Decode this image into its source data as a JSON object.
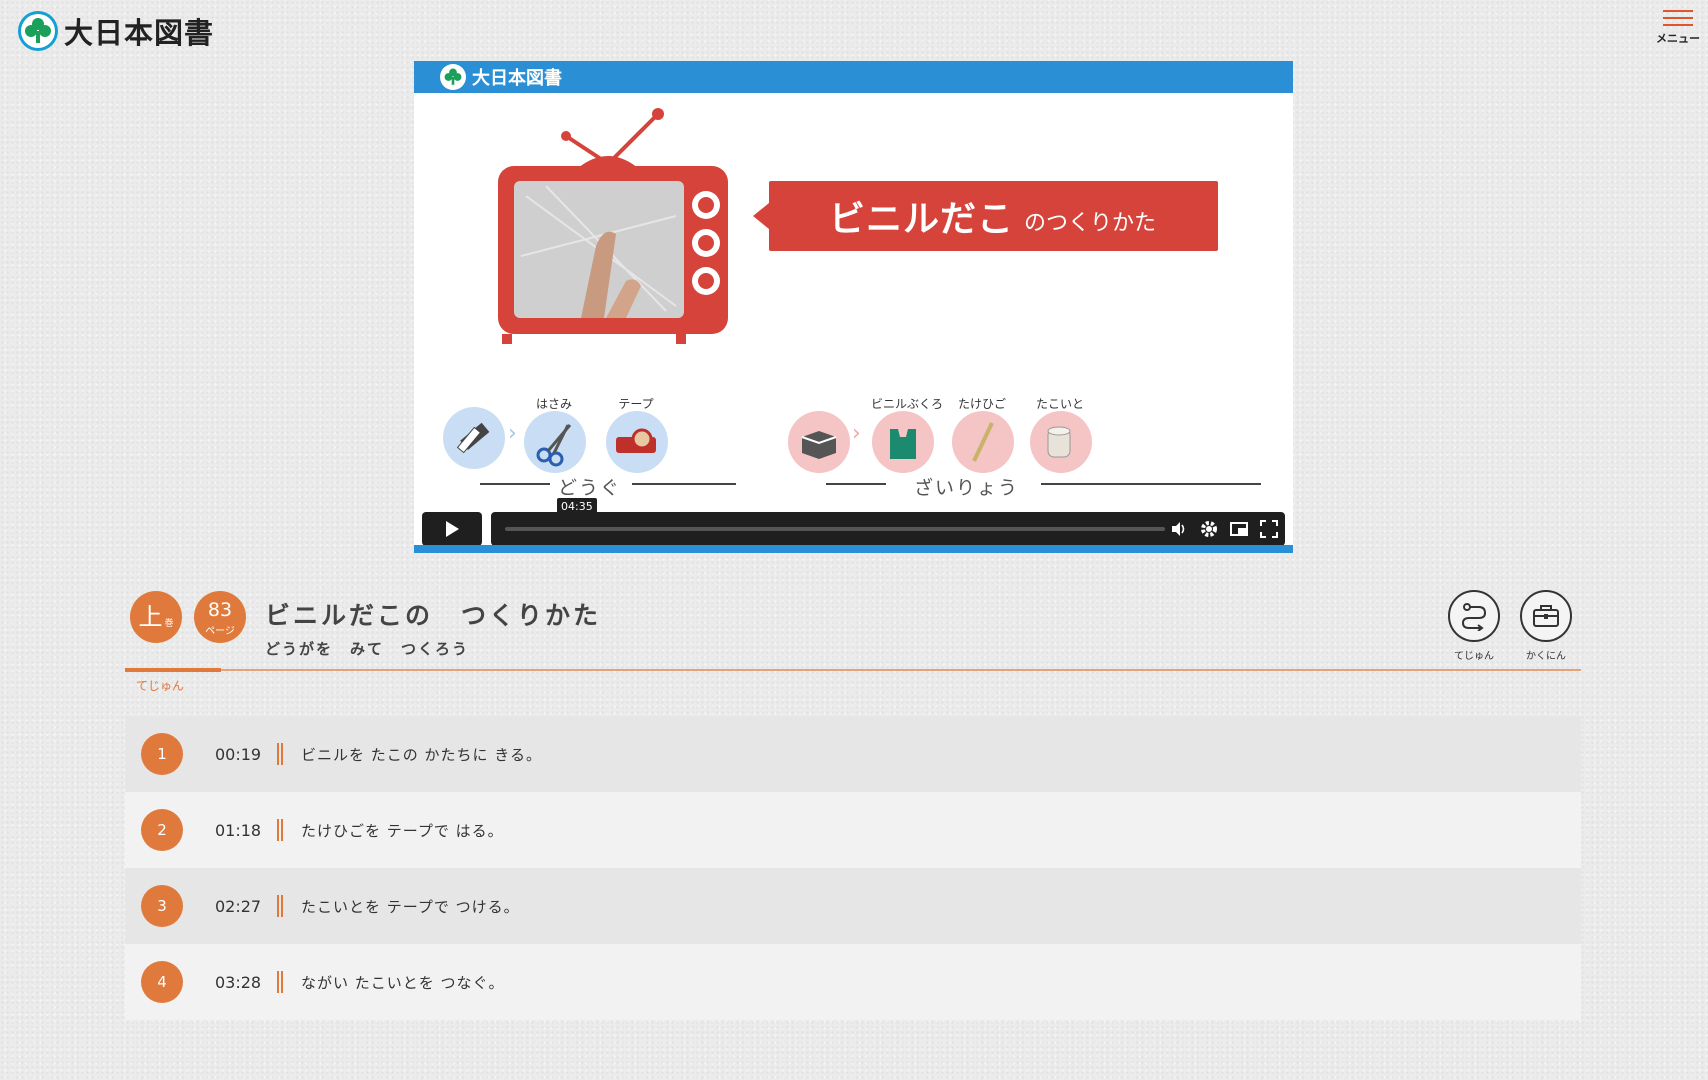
{
  "header": {
    "logo_text": "大日本図書",
    "menu_label": "メニュー"
  },
  "video": {
    "top_logo_text": "大日本図書",
    "title_big": "ビニルだこ",
    "title_small": "のつくりかた",
    "tools": {
      "group_label": "どうぐ",
      "items": [
        "はさみ",
        "テープ"
      ]
    },
    "materials": {
      "group_label": "ざいりょう",
      "items": [
        "ビニルぶくろ",
        "たけひご",
        "たこいと"
      ]
    },
    "time_tooltip": "04:35",
    "icons": [
      "play-icon",
      "volume-icon",
      "settings-icon",
      "pip-icon",
      "fullscreen-icon"
    ]
  },
  "lesson": {
    "volume_char": "上",
    "volume_suffix": "巻",
    "page_number": "83",
    "page_suffix": "ページ",
    "title": "ビニルだこの　つくりかた",
    "subtitle": "どうがを　みて　つくろう",
    "active_tab": "てじゅん",
    "buttons": {
      "steps_label": "てじゅん",
      "check_label": "かくにん"
    }
  },
  "steps": [
    {
      "num": "1",
      "time": "00:19",
      "text": "ビニルを たこの かたちに きる。"
    },
    {
      "num": "2",
      "time": "01:18",
      "text": "たけひごを テープで はる。"
    },
    {
      "num": "3",
      "time": "02:27",
      "text": "たこいとを テープで つける。"
    },
    {
      "num": "4",
      "time": "03:28",
      "text": "ながい たこいとを つなぐ。"
    }
  ],
  "colors": {
    "accent": "#e07a3c",
    "video_blue": "#2b8fd6",
    "banner_red": "#d5433a",
    "logo_blue": "#14a0d4"
  }
}
